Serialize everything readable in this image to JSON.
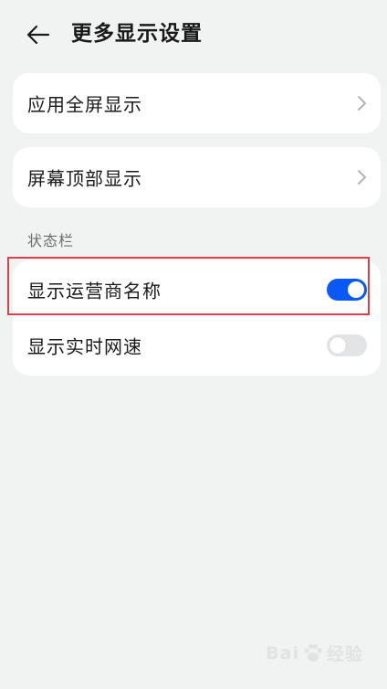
{
  "header": {
    "back_icon": "back-arrow-icon",
    "title": "更多显示设置"
  },
  "card_fullscreen": {
    "label": "应用全屏显示",
    "icon": "chevron-right-icon"
  },
  "card_top": {
    "label": "屏幕顶部显示",
    "icon": "chevron-right-icon"
  },
  "status_bar": {
    "section_title": "状态栏",
    "items": [
      {
        "label": "显示运营商名称",
        "toggle_on": true
      },
      {
        "label": "显示实时网速",
        "toggle_on": false
      }
    ]
  },
  "colors": {
    "background": "#f1f3f2",
    "toggle_on": "#0a59f7",
    "toggle_off": "#e3e4e5",
    "highlight": "#d9404a"
  },
  "watermark": {
    "text_left": "Bai",
    "text_right": "经验",
    "icon": "paw-logo-icon"
  }
}
